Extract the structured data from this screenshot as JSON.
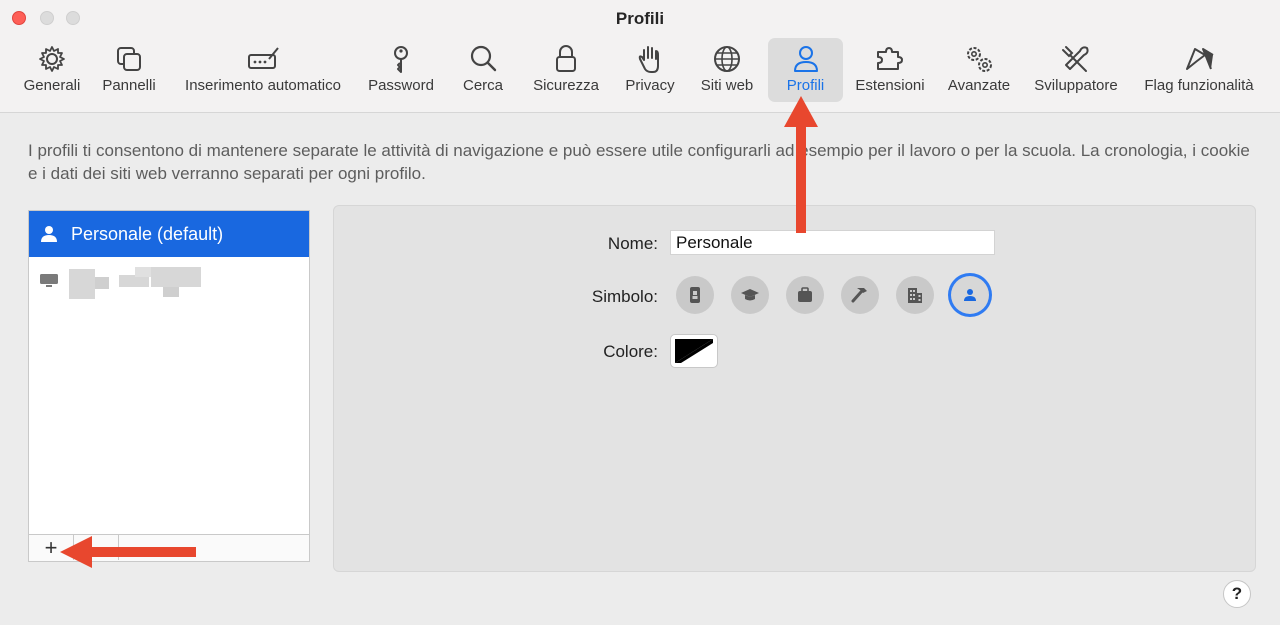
{
  "window": {
    "title": "Profili"
  },
  "toolbar": {
    "items": [
      {
        "label": "Generali",
        "icon": "gear-icon"
      },
      {
        "label": "Pannelli",
        "icon": "tabs-icon"
      },
      {
        "label": "Inserimento automatico",
        "icon": "autofill-icon"
      },
      {
        "label": "Password",
        "icon": "key-icon"
      },
      {
        "label": "Cerca",
        "icon": "search-icon"
      },
      {
        "label": "Sicurezza",
        "icon": "lock-icon"
      },
      {
        "label": "Privacy",
        "icon": "hand-icon"
      },
      {
        "label": "Siti web",
        "icon": "globe-icon"
      },
      {
        "label": "Profili",
        "icon": "person-icon",
        "active": true
      },
      {
        "label": "Estensioni",
        "icon": "puzzle-icon"
      },
      {
        "label": "Avanzate",
        "icon": "gears-icon"
      },
      {
        "label": "Sviluppatore",
        "icon": "tools-icon"
      },
      {
        "label": "Flag funzionalità",
        "icon": "flags-icon"
      }
    ]
  },
  "intro": "I profili ti consentono di mantenere separate le attività di navigazione e può essere utile configurarli ad esempio per il lavoro o per la scuola. La cronologia, i cookie e i dati dei siti web verranno separati per ogni profilo.",
  "profiles": {
    "selected": "Personale (default)",
    "add_label": "+"
  },
  "detail": {
    "name_label": "Nome:",
    "name_value": "Personale",
    "symbol_label": "Simbolo:",
    "symbols": [
      "id-badge-icon",
      "graduation-cap-icon",
      "briefcase-icon",
      "hammer-icon",
      "building-icon",
      "person-icon"
    ],
    "selected_symbol": "person-icon",
    "color_label": "Colore:"
  },
  "help": "?",
  "colors": {
    "accent": "#1968e0",
    "annotation_arrow": "#e8472e"
  }
}
